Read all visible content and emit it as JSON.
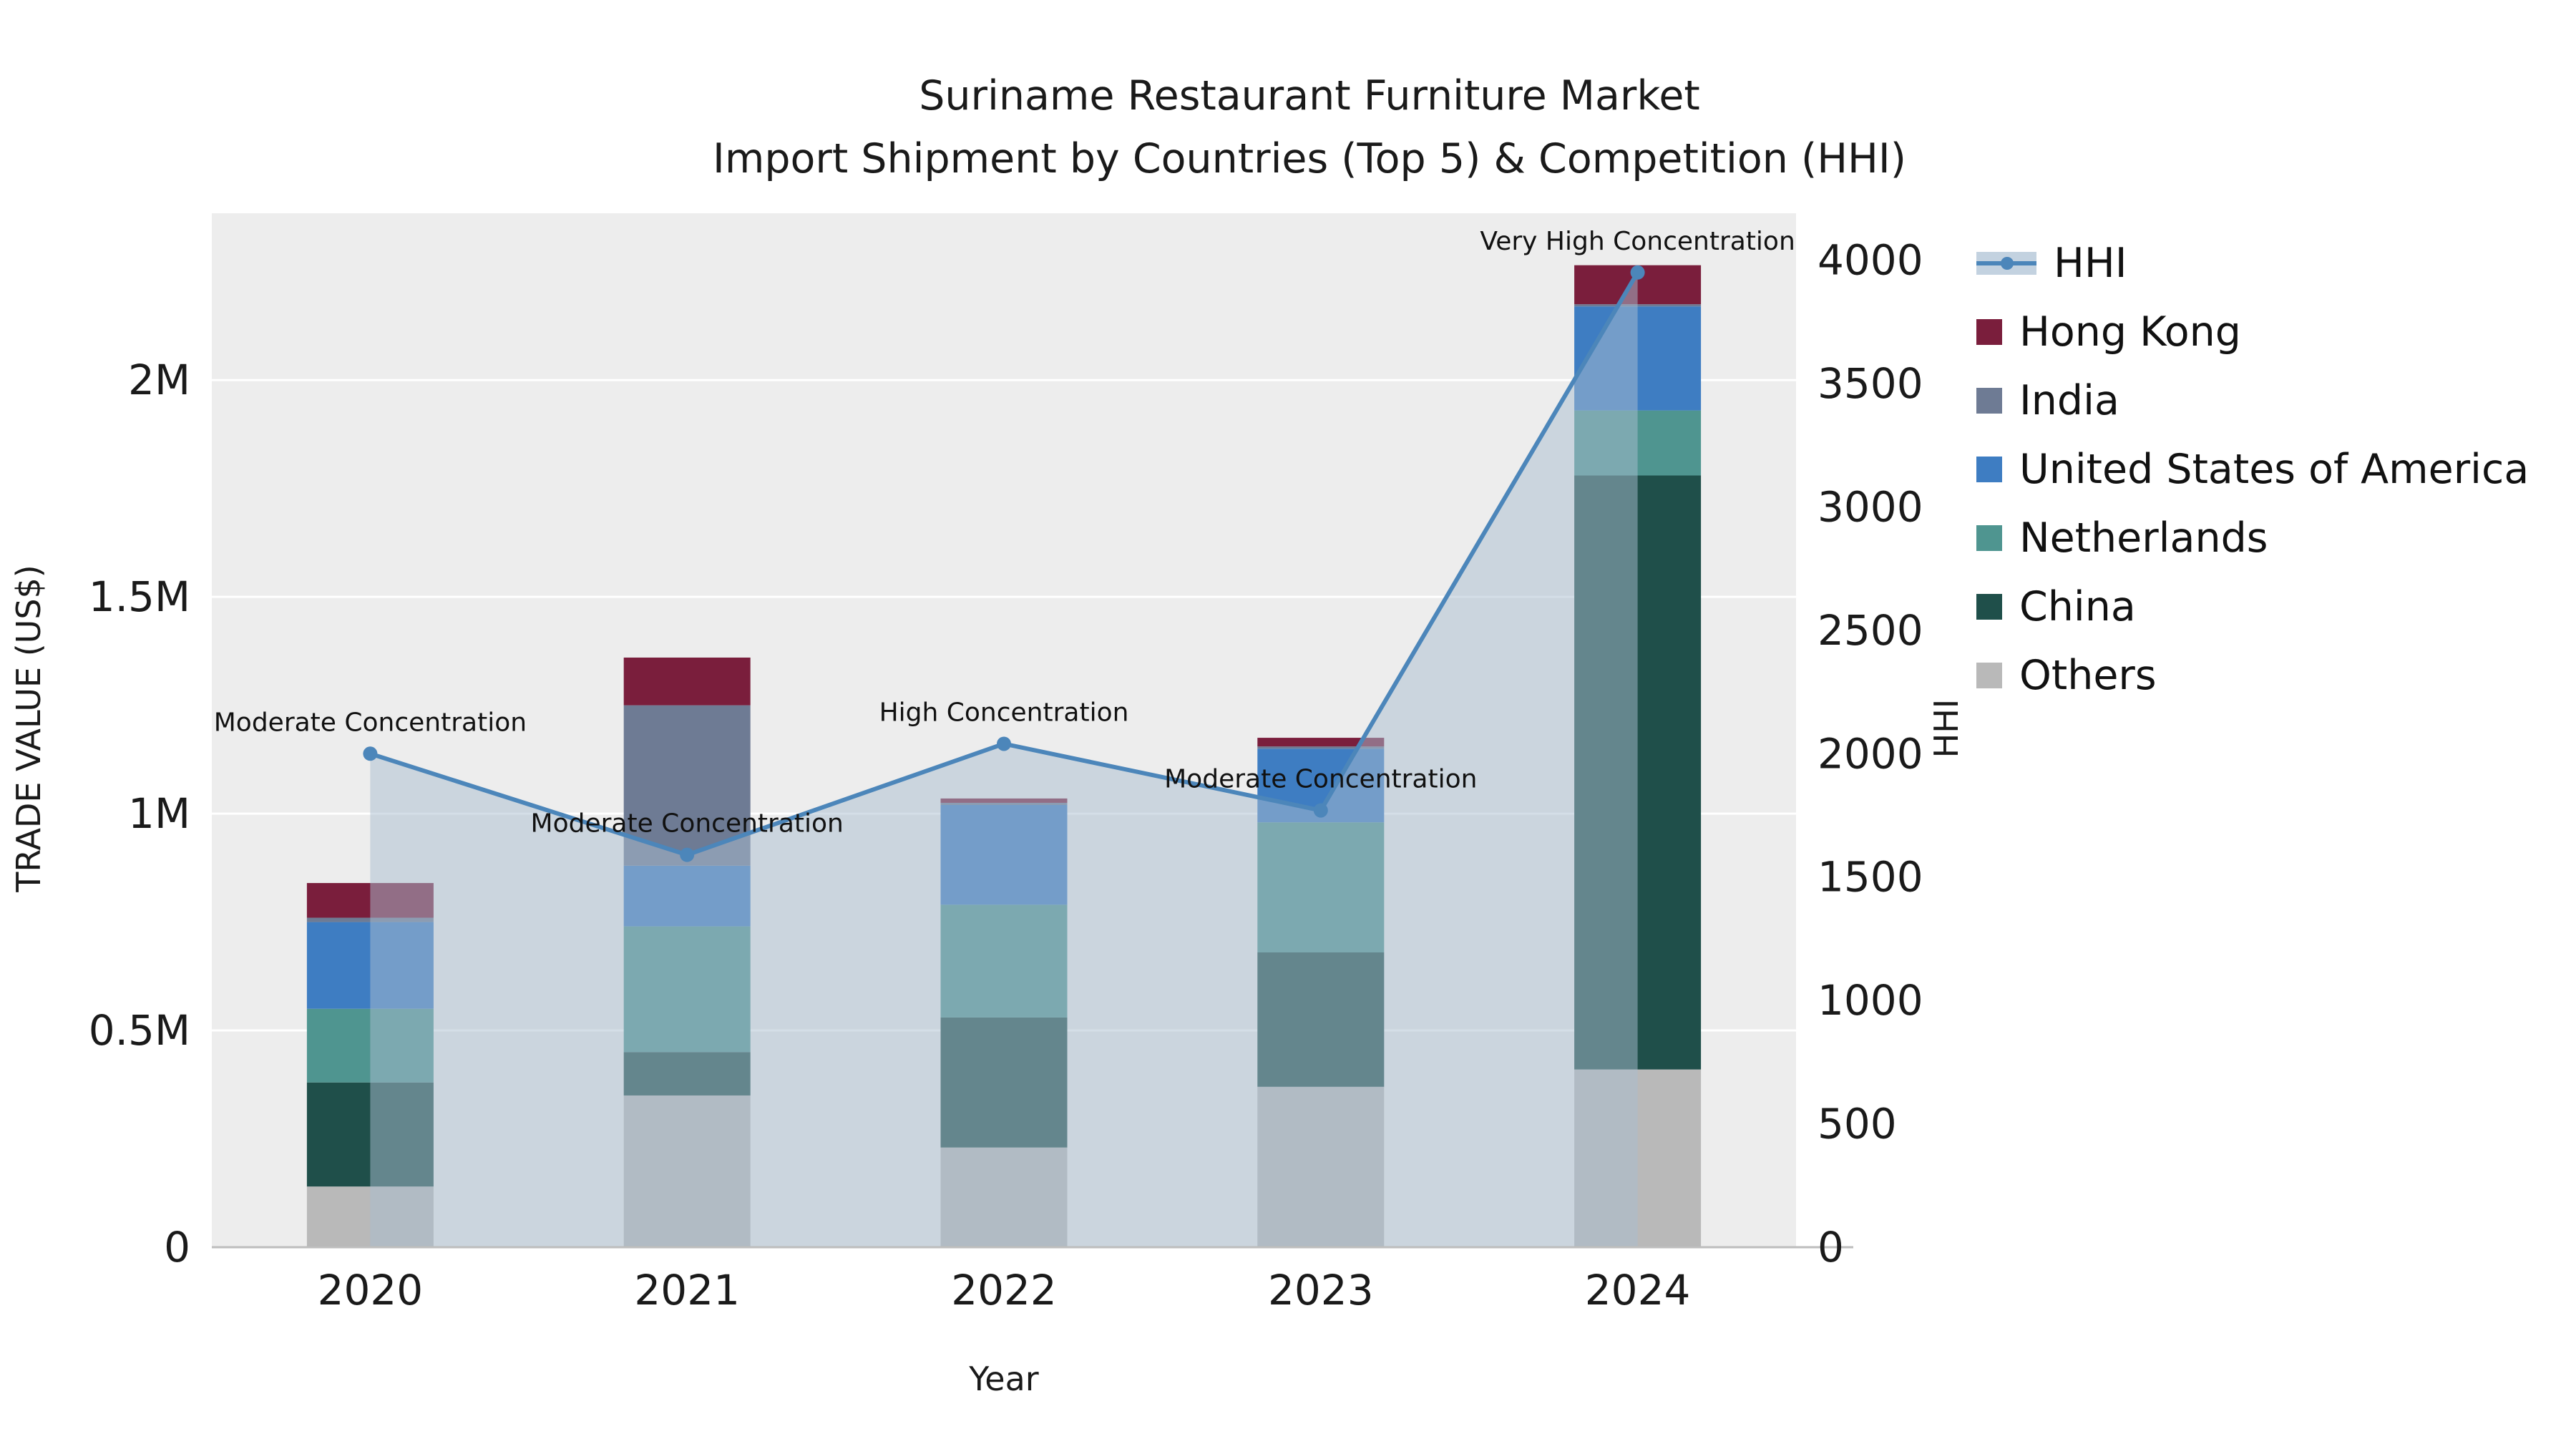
{
  "title": {
    "line1": "Suriname Restaurant Furniture Market",
    "line2": "Import Shipment by Countries (Top 5) & Competition (HHI)"
  },
  "axes": {
    "x_label": "Year",
    "y_left_label": "TRADE VALUE (US$)",
    "y_right_label": "HHI",
    "x_ticks": [
      "2020",
      "2021",
      "2022",
      "2023",
      "2024"
    ],
    "y_left_ticks": [
      {
        "value": 0,
        "label": "0"
      },
      {
        "value": 500000,
        "label": "0.5M"
      },
      {
        "value": 1000000,
        "label": "1M"
      },
      {
        "value": 1500000,
        "label": "1.5M"
      },
      {
        "value": 2000000,
        "label": "2M"
      }
    ],
    "y_right_ticks": [
      {
        "value": 0,
        "label": "0"
      },
      {
        "value": 500,
        "label": "500"
      },
      {
        "value": 1000,
        "label": "1000"
      },
      {
        "value": 1500,
        "label": "1500"
      },
      {
        "value": 2000,
        "label": "2000"
      },
      {
        "value": 2500,
        "label": "2500"
      },
      {
        "value": 3000,
        "label": "3000"
      },
      {
        "value": 3500,
        "label": "3500"
      },
      {
        "value": 4000,
        "label": "4000"
      }
    ]
  },
  "legend": {
    "items": [
      {
        "label": "HHI",
        "type": "line",
        "color": "#4c86ba"
      },
      {
        "label": "Hong Kong",
        "type": "square",
        "color": "#7a1e3c"
      },
      {
        "label": "India",
        "type": "square",
        "color": "#6e7b94"
      },
      {
        "label": "United States of America",
        "type": "square",
        "color": "#3e7dc2"
      },
      {
        "label": "Netherlands",
        "type": "square",
        "color": "#4f9590"
      },
      {
        "label": "China",
        "type": "square",
        "color": "#1f4f4a"
      },
      {
        "label": "Others",
        "type": "square",
        "color": "#b9b9b9"
      }
    ]
  },
  "chart_data": {
    "type": "bar",
    "subtype": "stacked-bar-with-line-overlay",
    "x": [
      2020,
      2021,
      2022,
      2023,
      2024
    ],
    "bar_unit": "US$",
    "bar_series_bottom_to_top": [
      {
        "name": "Others",
        "color": "#b9b9b9",
        "values": [
          140000,
          350000,
          230000,
          370000,
          410000
        ]
      },
      {
        "name": "China",
        "color": "#1f4f4a",
        "values": [
          240000,
          100000,
          300000,
          310000,
          1370000
        ]
      },
      {
        "name": "Netherlands",
        "color": "#4f9590",
        "values": [
          170000,
          290000,
          260000,
          300000,
          150000
        ]
      },
      {
        "name": "United States of America",
        "color": "#3e7dc2",
        "values": [
          200000,
          140000,
          230000,
          170000,
          240000
        ]
      },
      {
        "name": "India",
        "color": "#6e7b94",
        "values": [
          10000,
          370000,
          5000,
          5000,
          5000
        ]
      },
      {
        "name": "Hong Kong",
        "color": "#7a1e3c",
        "values": [
          80000,
          110000,
          10000,
          20000,
          90000
        ]
      }
    ],
    "line_series": {
      "name": "HHI",
      "color": "#4c86ba",
      "area_fill": "#a9bdd0",
      "values": [
        2000,
        1590,
        2040,
        1770,
        3950
      ]
    },
    "annotations": [
      "Moderate Concentration",
      "Moderate Concentration",
      "High Concentration",
      "Moderate Concentration",
      "Very High Concentration"
    ],
    "y_left_range": [
      0,
      2384900
    ],
    "y_right_range": [
      0,
      4190
    ],
    "grid": true,
    "legend_position": "right"
  }
}
